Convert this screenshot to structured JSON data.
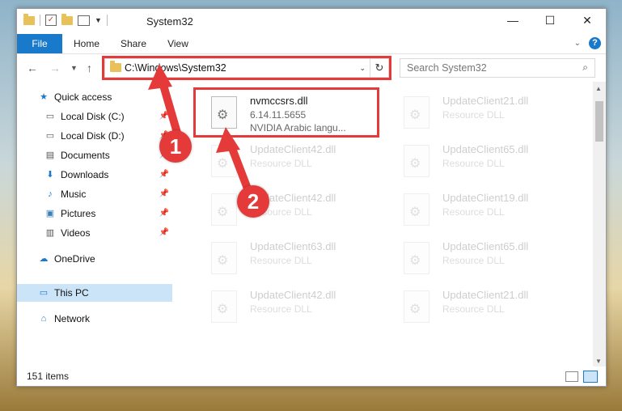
{
  "window": {
    "title": "System32",
    "controls": {
      "minimize": "—",
      "maximize": "☐",
      "close": "✕"
    }
  },
  "ribbon": {
    "tabs": [
      "File",
      "Home",
      "Share",
      "View"
    ],
    "help": "?"
  },
  "nav": {
    "address": "C:\\Windows\\System32",
    "search_placeholder": "Search System32"
  },
  "sidebar": {
    "items": [
      {
        "label": "Quick access",
        "icon": "star-icon"
      },
      {
        "label": "Local Disk (C:)",
        "icon": "drive-icon"
      },
      {
        "label": "Local Disk (D:)",
        "icon": "drive-icon"
      },
      {
        "label": "Documents",
        "icon": "documents-icon"
      },
      {
        "label": "Downloads",
        "icon": "download-icon"
      },
      {
        "label": "Music",
        "icon": "music-icon"
      },
      {
        "label": "Pictures",
        "icon": "pictures-icon"
      },
      {
        "label": "Videos",
        "icon": "videos-icon"
      },
      {
        "label": "OneDrive",
        "icon": "cloud-icon"
      },
      {
        "label": "This PC",
        "icon": "computer-icon"
      },
      {
        "label": "Network",
        "icon": "network-icon"
      }
    ]
  },
  "files": {
    "highlighted": {
      "name": "nvmccsrs.dll",
      "version": "6.14.11.5655",
      "description": "NVIDIA Arabic langu..."
    },
    "faded": [
      {
        "name": "UpdateClient21.dll",
        "type": "Resource DLL"
      },
      {
        "name": "UpdateClient42.dll",
        "type": "Resource DLL"
      },
      {
        "name": "UpdateClient65.dll",
        "type": "Resource DLL"
      },
      {
        "name": "UpdateClient42.dll",
        "type": "Resource DLL"
      },
      {
        "name": "UpdateClient19.dll",
        "type": "Resource DLL"
      },
      {
        "name": "UpdateClient63.dll",
        "type": "Resource DLL"
      },
      {
        "name": "UpdateClient65.dll",
        "type": "Resource DLL"
      },
      {
        "name": "UpdateClient42.dll",
        "type": "Resource DLL"
      },
      {
        "name": "UpdateClient21.dll",
        "type": "Resource DLL"
      }
    ]
  },
  "status": {
    "item_count": "151 items"
  },
  "annotations": {
    "step1": "1",
    "step2": "2",
    "color": "#e53a3a"
  },
  "colors": {
    "accent": "#1979ca",
    "selected": "#cce4f7"
  }
}
